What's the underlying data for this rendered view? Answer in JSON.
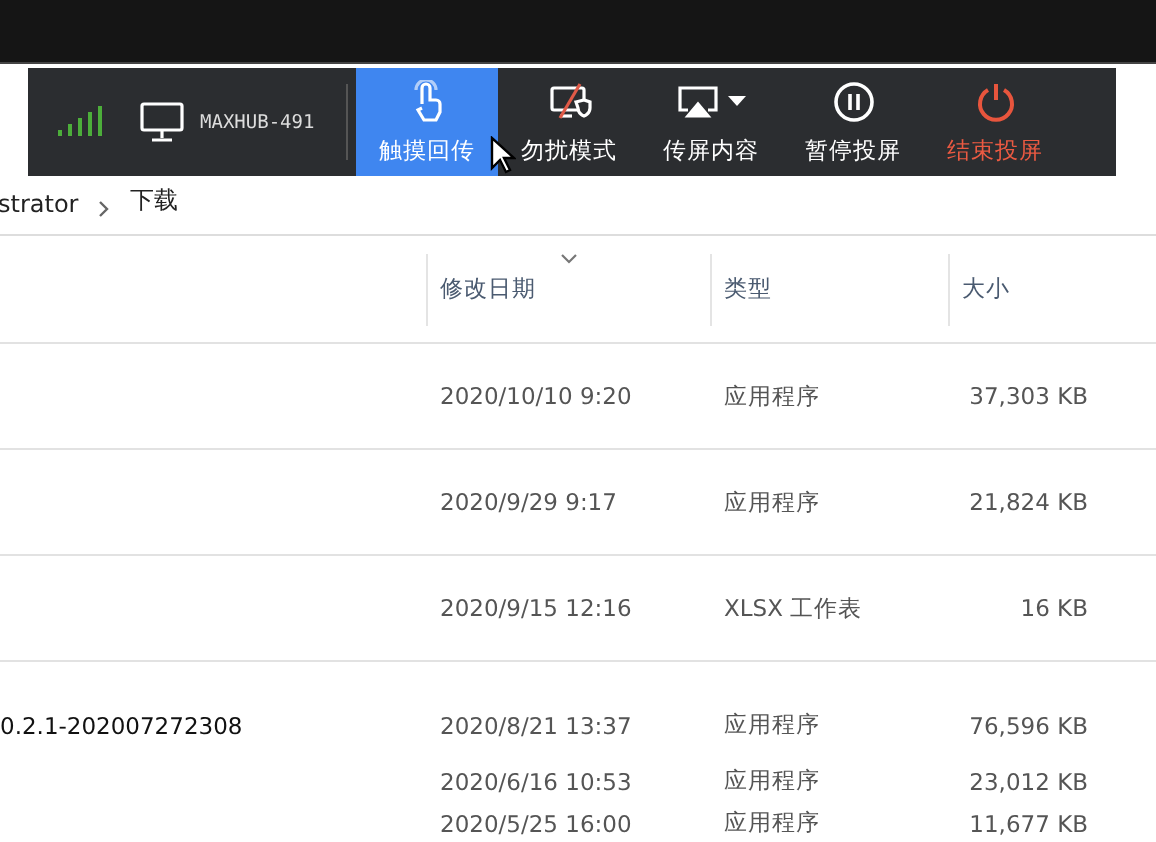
{
  "toolbar": {
    "device_name": "MAXHUB-491",
    "buttons": [
      {
        "label": "触摸回传",
        "selected": true,
        "kind": "plain"
      },
      {
        "label": "勿扰模式",
        "selected": false,
        "kind": "plain"
      },
      {
        "label": "传屏内容",
        "selected": false,
        "kind": "dropdown"
      },
      {
        "label": "暂停投屏",
        "selected": false,
        "kind": "plain"
      },
      {
        "label": "结束投屏",
        "selected": false,
        "kind": "danger"
      }
    ]
  },
  "breadcrumb": [
    {
      "label": "strator"
    },
    {
      "label": "下载"
    }
  ],
  "table": {
    "columns": [
      {
        "label": "修改日期",
        "sorted": true
      },
      {
        "label": "类型",
        "sorted": false
      },
      {
        "label": "大小",
        "sorted": false
      }
    ],
    "rows": [
      {
        "kind": "spaced",
        "date": "2020/10/10 9:20",
        "type": "应用程序",
        "size": "37,303 KB"
      },
      {
        "kind": "spaced",
        "date": "2020/9/29 9:17",
        "type": "应用程序",
        "size": "21,824 KB"
      },
      {
        "kind": "spaced",
        "date": "2020/9/15 12:16",
        "type": "XLSX 工作表",
        "size": "16 KB"
      },
      {
        "kind": "compact",
        "name": "0.2.1-202007272308",
        "date": "2020/8/21 13:37",
        "type": "应用程序",
        "size": "76,596 KB"
      },
      {
        "kind": "compact",
        "date": "2020/6/16 10:53",
        "type": "应用程序",
        "size": "23,012 KB"
      },
      {
        "kind": "compact",
        "date": "2020/5/25 16:00",
        "type": "应用程序",
        "size": "11,677 KB"
      }
    ]
  }
}
